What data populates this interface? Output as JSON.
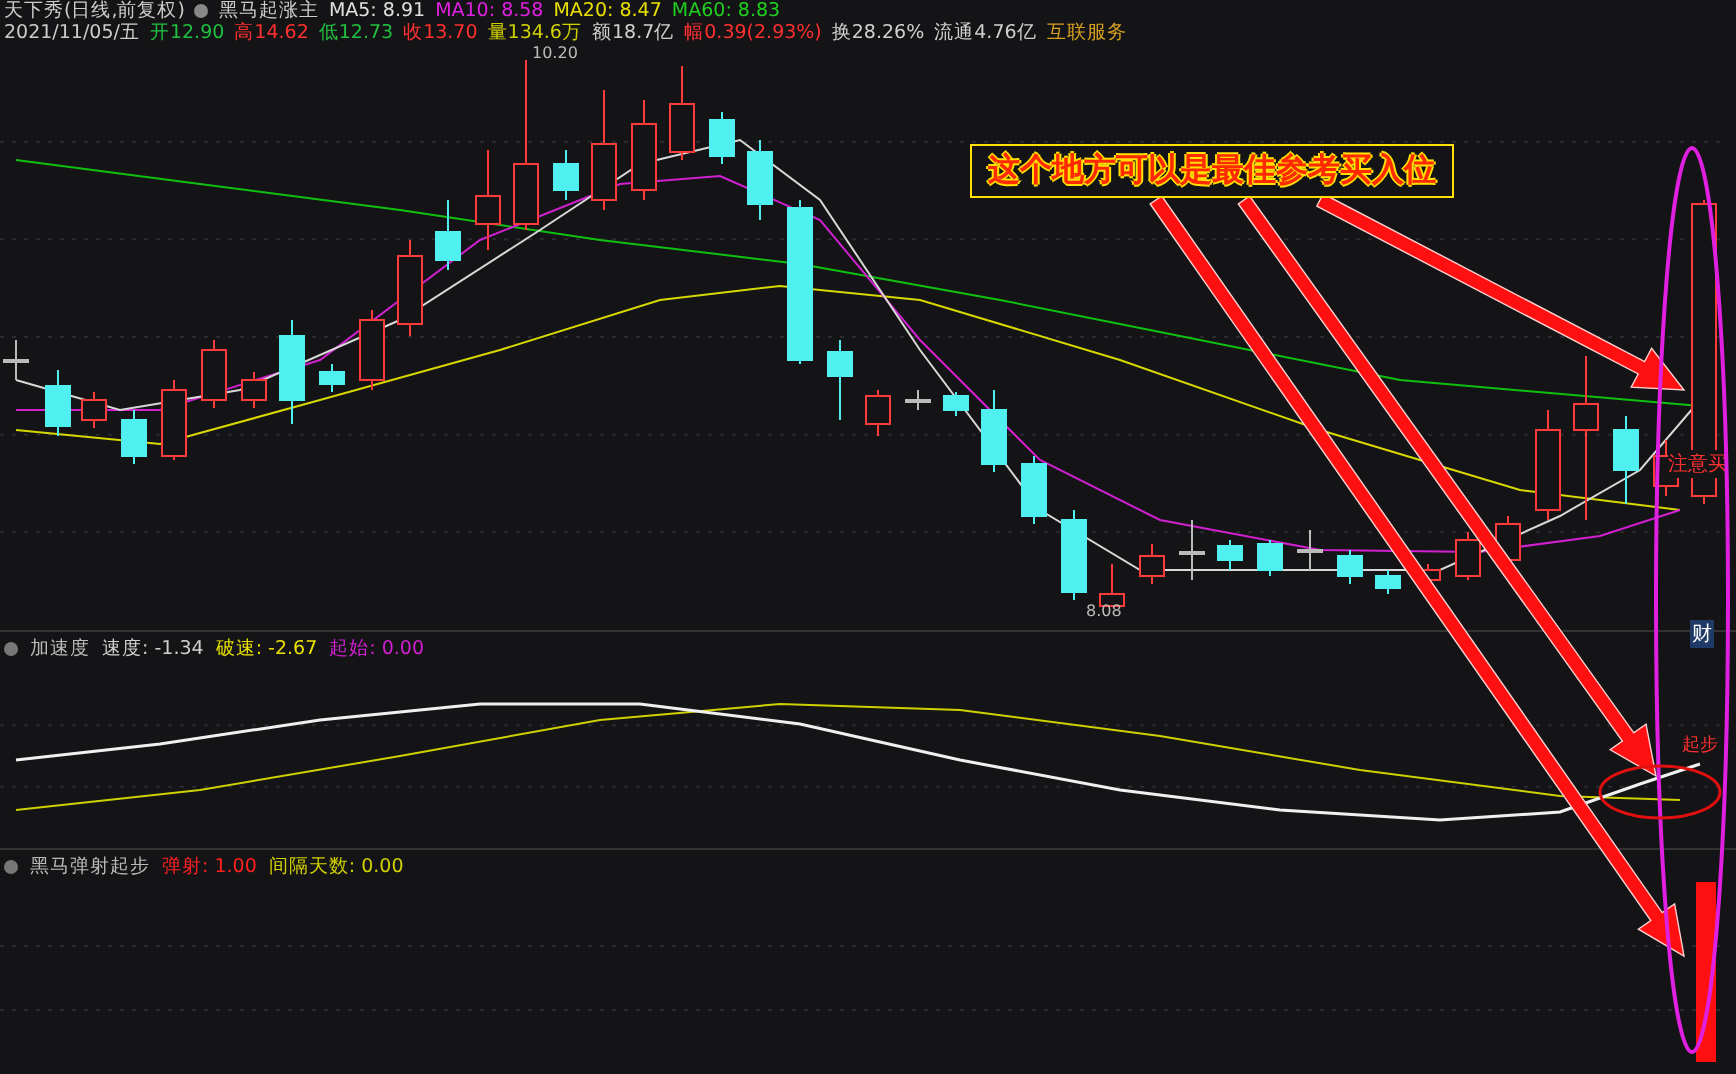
{
  "header": {
    "title": "天下秀(日线,前复权)",
    "indicator": "黑马起涨主",
    "ma": [
      {
        "text": "MA5: 8.91",
        "color": "#e0e0e0"
      },
      {
        "text": "MA10: 8.58",
        "color": "#e020e0"
      },
      {
        "text": "MA20: 8.47",
        "color": "#e8e000"
      },
      {
        "text": "MA60: 8.83",
        "color": "#20d020"
      }
    ],
    "date": "2021/11/05/五",
    "quote": [
      {
        "text": "开12.90",
        "color": "#20c040"
      },
      {
        "text": "高14.62",
        "color": "#ff3030"
      },
      {
        "text": "低12.73",
        "color": "#20c040"
      },
      {
        "text": "收13.70",
        "color": "#ff3030"
      },
      {
        "text": "量134.6万",
        "color": "#d0d000"
      },
      {
        "text": "额18.7亿",
        "color": "#d0d0d0"
      },
      {
        "text": "幅0.39(2.93%)",
        "color": "#ff3030"
      },
      {
        "text": "换28.26%",
        "color": "#d0d0d0"
      },
      {
        "text": "流通4.76亿",
        "color": "#d0d0d0"
      },
      {
        "text": "互联服务",
        "color": "#d8a020"
      }
    ]
  },
  "chart": {
    "high_label": "10.20",
    "low_label": "8.08",
    "signal_text": "注意买",
    "badge": "财"
  },
  "indicators": [
    {
      "name": "加速度",
      "items": [
        {
          "text": "速度: -1.34",
          "color": "#d0d0d0"
        },
        {
          "text": "破速: -2.67",
          "color": "#e8e000"
        },
        {
          "text": "起始: 0.00",
          "color": "#d020d0"
        }
      ],
      "signal_text": "起步"
    },
    {
      "name": "黑马弹射起步",
      "items": [
        {
          "text": "弹射: 1.00",
          "color": "#ff2020"
        },
        {
          "text": "间隔天数: 0.00",
          "color": "#d0d000"
        }
      ]
    }
  ],
  "annotation": {
    "text": "这个地方可以是最佳参考买入位"
  }
}
